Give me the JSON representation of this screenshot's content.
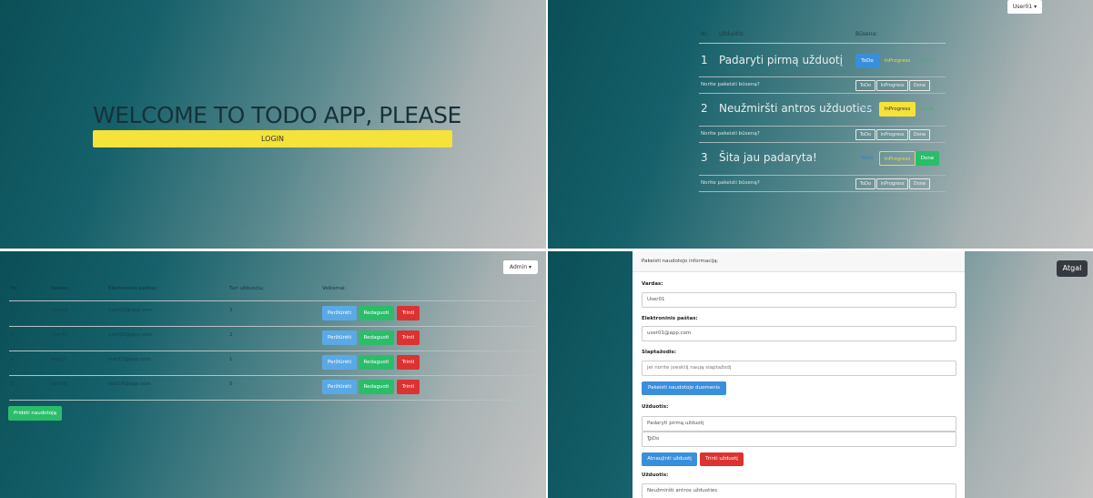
{
  "welcome": {
    "title": "WELCOME TO TODO APP, PLEASE",
    "login_label": "LOGIN"
  },
  "user_tasks": {
    "user_menu": "User01",
    "headers": {
      "nr": "Nr.",
      "task": "Užduotis:",
      "status": "Būsena:"
    },
    "rows": [
      {
        "num": "1",
        "text": "Padaryti pirmą užduotį",
        "todo": "ToDo",
        "inprogress": "InProgress",
        "done": "Done"
      },
      {
        "num": "2",
        "text": "Neužmiršti antros užduoties",
        "todo": "ToDo",
        "inprogress": "InProgress",
        "done": "Done"
      },
      {
        "num": "3",
        "text": "Šita jau padaryta!",
        "todo": "ToDo",
        "inprogress": "InProgress",
        "done": "Done"
      }
    ],
    "change_prompt": "Norite pakeisti būseną?",
    "change_buttons": {
      "todo": "ToDo",
      "inprogress": "InProgress",
      "done": "Done"
    }
  },
  "admin": {
    "menu": "Admin",
    "headers": {
      "nr": "Nr.",
      "name": "Vardas:",
      "email": "Elektroninis paštas:",
      "tasks": "Turi užduočių:",
      "actions": "Veiksmai:"
    },
    "rows": [
      {
        "nr": "2",
        "name": "User01",
        "email": "user01@app.com",
        "tasks": "3"
      },
      {
        "nr": "3",
        "name": "User02",
        "email": "user02@app.com",
        "tasks": "2"
      },
      {
        "nr": "4",
        "name": "test17",
        "email": "test17@app.com",
        "tasks": "1"
      },
      {
        "nr": "5",
        "name": "test19",
        "email": "test19@app.com",
        "tasks": "0"
      }
    ],
    "view_label": "Peržiūrėti",
    "edit_label": "Redaguoti",
    "delete_label": "Trinti",
    "add_user_label": "Pridėti naudotoją"
  },
  "edit_user": {
    "back_label": "Atgal",
    "header": "Pakeisti naudotojo informaciją:",
    "name_label": "Vardas:",
    "name_value": "User01",
    "email_label": "Elektroninis paštas:",
    "email_value": "user01@app.com",
    "password_label": "Slaptažodis:",
    "password_placeholder": "jei norite įvesktiį naują slaptažodį",
    "save_label": "Pakeisti naudotojo duomenis",
    "task_label": "Užduotis:",
    "task1_value": "Padaryti pirmą užduotį",
    "task1_status": "ToDo",
    "update_label": "Atnaujinti užduotį",
    "delete_task_label": "Trinti užduotį",
    "task2_label": "Užduotis:",
    "task2_value": "Neužmiršti antros užduoties"
  },
  "colors": {
    "blue": "#3a8fdc",
    "yellow": "#f5e23a",
    "green": "#2bbd6a",
    "red": "#dc3232",
    "light_blue": "#5aa9e6"
  }
}
